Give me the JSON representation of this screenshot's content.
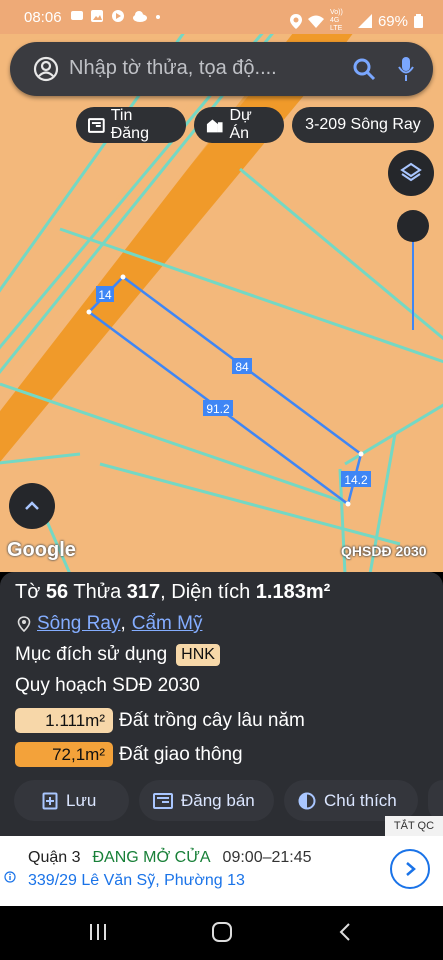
{
  "status_bar": {
    "time": "08:06",
    "network": "Vo)) 4G LTE",
    "battery": "69%"
  },
  "search": {
    "placeholder": "Nhập tờ thửa, tọa độ...."
  },
  "chips": [
    {
      "label": "Tin Đăng",
      "icon": "newspaper-icon"
    },
    {
      "label": "Dự Án",
      "icon": "buildings-icon"
    },
    {
      "label": "3-209 Sông Ray",
      "icon": ""
    }
  ],
  "map": {
    "parcel_edges": [
      "14",
      "84",
      "91.2",
      "14.2"
    ],
    "google_label": "Google",
    "layer_label": "QHSDĐ 2030",
    "colors": {
      "land": "#f3b87b",
      "road": "#f09a2a",
      "boundary": "#74d8c4",
      "parcel": "#3f86f5"
    }
  },
  "parcel": {
    "to_label": "Tờ",
    "to_value": "56",
    "thua_label": "Thửa",
    "thua_value": "317",
    "area_label": "Diện tích",
    "area_value": "1.183m²",
    "location_commune": "Sông Ray",
    "location_separator": ",",
    "location_district": "Cẩm Mỹ",
    "purpose_label": "Mục đích sử dụng",
    "purpose_code": "HNK",
    "plan_label": "Quy hoạch SDĐ 2030",
    "land_uses": [
      {
        "area": "1.111m²",
        "label": "Đất trồng cây lâu năm",
        "color": "#f7d7a9"
      },
      {
        "area": "72,1m²",
        "label": "Đất giao thông",
        "color": "#f3a23a"
      }
    ]
  },
  "actions": [
    {
      "label": "Lưu",
      "icon": "bookmark-add-icon"
    },
    {
      "label": "Đăng bán",
      "icon": "listing-icon"
    },
    {
      "label": "Chú thích",
      "icon": "contrast-icon"
    }
  ],
  "ad": {
    "close_label": "TẮT QC",
    "place": "Quận 3",
    "status": "ĐANG MỞ CỬA",
    "hours": "09:00–21:45",
    "address": "339/29 Lê Văn Sỹ, Phường 13"
  }
}
